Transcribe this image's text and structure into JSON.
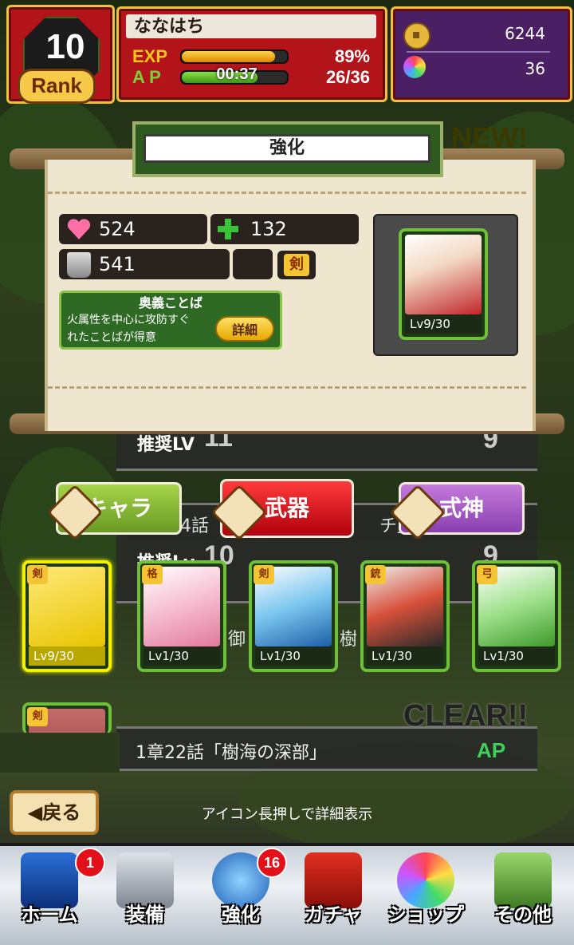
{
  "header": {
    "rank_level": "10",
    "rank_label": "Rank",
    "player_name": "ななはち",
    "exp_label": "EXP",
    "ap_label": "A P",
    "exp_percent": "89%",
    "exp_fill": 0.89,
    "ap_timer": "00:37",
    "ap_value": "26/36",
    "ap_fill": 0.72,
    "coins": "6244",
    "souls": "36"
  },
  "panel": {
    "title": "強化",
    "hp": "524",
    "heal": "132",
    "defense": "541",
    "weapon_type": "剣",
    "skill_title": "奥義ことば",
    "skill_desc": "火属性を中心に攻防すぐ\nれたことばが得意",
    "detail_button": "詳細",
    "selected_level": "Lv9/30"
  },
  "quests": {
    "row1_label": "推奨LV",
    "row1_level": "11",
    "row1_ap": "9",
    "row2_text": "4話「",
    "row2_text_end": "チ」",
    "row2_label": "推奨Lv",
    "row2_level": "10",
    "row2_ap": "9",
    "row3_text": "御",
    "row3_text_end": "樹",
    "row4_clear": "CLEAR!!",
    "row4_title": "1章22話「樹海の深部」",
    "row4_ap": "AP",
    "new_badge": "NEW!"
  },
  "tabs": [
    {
      "label": "キャラ"
    },
    {
      "label": "武器"
    },
    {
      "label": "式神"
    }
  ],
  "cards": [
    {
      "badge": "剣",
      "level": "Lv9/30"
    },
    {
      "badge": "格",
      "level": "Lv1/30"
    },
    {
      "badge": "剣",
      "level": "Lv1/30"
    },
    {
      "badge": "銃",
      "level": "Lv1/30"
    },
    {
      "badge": "弓",
      "level": "Lv1/30"
    },
    {
      "badge": "剣",
      "level": ""
    }
  ],
  "footer": {
    "back_button": "◀戻る",
    "hint": "アイコン長押しで詳細表示"
  },
  "nav": [
    {
      "label": "ホーム",
      "badge": "1"
    },
    {
      "label": "装備",
      "badge": ""
    },
    {
      "label": "強化",
      "badge": "16"
    },
    {
      "label": "ガチャ",
      "badge": ""
    },
    {
      "label": "ショップ",
      "badge": ""
    },
    {
      "label": "その他",
      "badge": ""
    }
  ],
  "colors": {
    "header_red": "#b3141a",
    "gold": "#f0c23a",
    "selected_card": "#f5f000",
    "card_border": "#6fbf3a"
  }
}
